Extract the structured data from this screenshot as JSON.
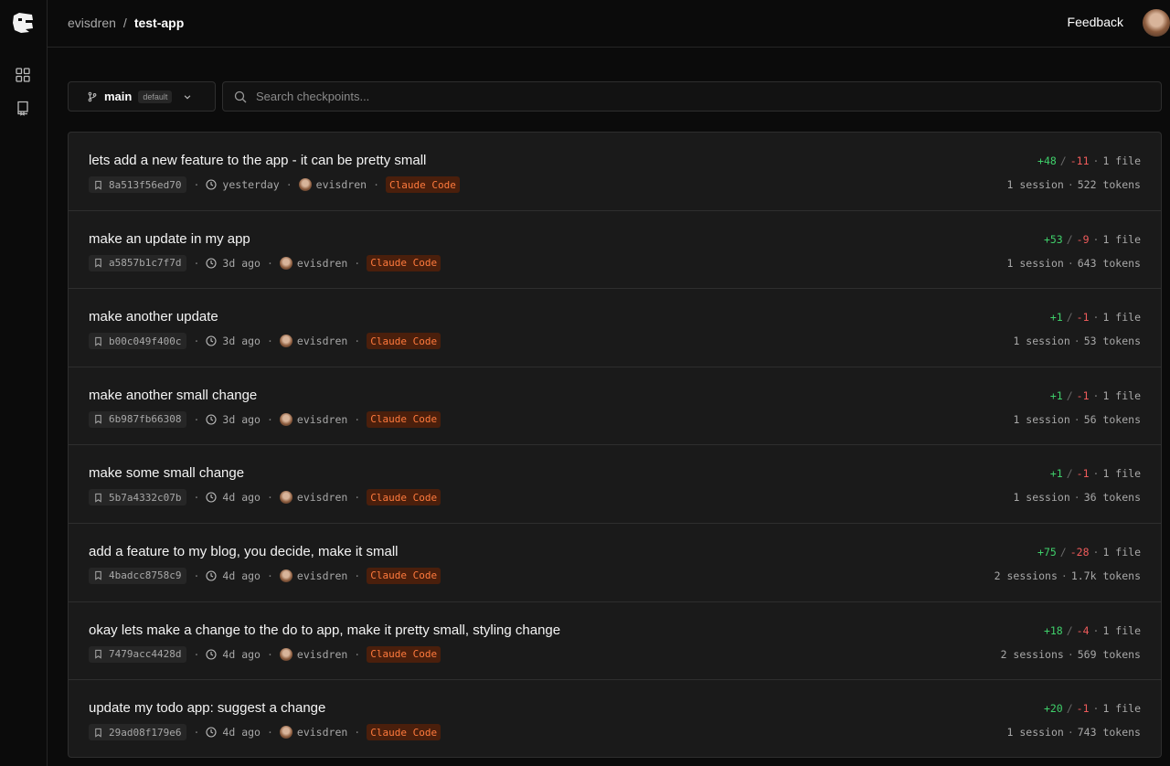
{
  "header": {
    "owner": "evisdren",
    "separator": "/",
    "repo": "test-app",
    "feedback_label": "Feedback"
  },
  "branch": {
    "name": "main",
    "badge": "default"
  },
  "search": {
    "placeholder": "Search checkpoints..."
  },
  "colors": {
    "additions": "#3fcf6a",
    "deletions": "#ef5b5b",
    "agent_badge_text": "#ff7a3d",
    "agent_badge_bg": "#4a1f0c"
  },
  "checkpoints": [
    {
      "title": "lets add a new feature to the app - it can be pretty small",
      "hash": "8a513f56ed70",
      "time": "yesterday",
      "author": "evisdren",
      "agent": "Claude Code",
      "additions": "+48",
      "deletions": "-11",
      "files": "1 file",
      "sessions": "1 session",
      "tokens": "522 tokens"
    },
    {
      "title": "make an update in my app",
      "hash": "a5857b1c7f7d",
      "time": "3d ago",
      "author": "evisdren",
      "agent": "Claude Code",
      "additions": "+53",
      "deletions": "-9",
      "files": "1 file",
      "sessions": "1 session",
      "tokens": "643 tokens"
    },
    {
      "title": "make another update",
      "hash": "b00c049f400c",
      "time": "3d ago",
      "author": "evisdren",
      "agent": "Claude Code",
      "additions": "+1",
      "deletions": "-1",
      "files": "1 file",
      "sessions": "1 session",
      "tokens": "53 tokens"
    },
    {
      "title": "make another small change",
      "hash": "6b987fb66308",
      "time": "3d ago",
      "author": "evisdren",
      "agent": "Claude Code",
      "additions": "+1",
      "deletions": "-1",
      "files": "1 file",
      "sessions": "1 session",
      "tokens": "56 tokens"
    },
    {
      "title": "make some small change",
      "hash": "5b7a4332c07b",
      "time": "4d ago",
      "author": "evisdren",
      "agent": "Claude Code",
      "additions": "+1",
      "deletions": "-1",
      "files": "1 file",
      "sessions": "1 session",
      "tokens": "36 tokens"
    },
    {
      "title": "add a feature to my blog, you decide, make it small",
      "hash": "4badcc8758c9",
      "time": "4d ago",
      "author": "evisdren",
      "agent": "Claude Code",
      "additions": "+75",
      "deletions": "-28",
      "files": "1 file",
      "sessions": "2 sessions",
      "tokens": "1.7k tokens"
    },
    {
      "title": "okay lets make a change to the do to app, make it pretty small, styling change",
      "hash": "7479acc4428d",
      "time": "4d ago",
      "author": "evisdren",
      "agent": "Claude Code",
      "additions": "+18",
      "deletions": "-4",
      "files": "1 file",
      "sessions": "2 sessions",
      "tokens": "569 tokens"
    },
    {
      "title": "update my todo app: suggest a change",
      "hash": "29ad08f179e6",
      "time": "4d ago",
      "author": "evisdren",
      "agent": "Claude Code",
      "additions": "+20",
      "deletions": "-1",
      "files": "1 file",
      "sessions": "1 session",
      "tokens": "743 tokens"
    }
  ]
}
